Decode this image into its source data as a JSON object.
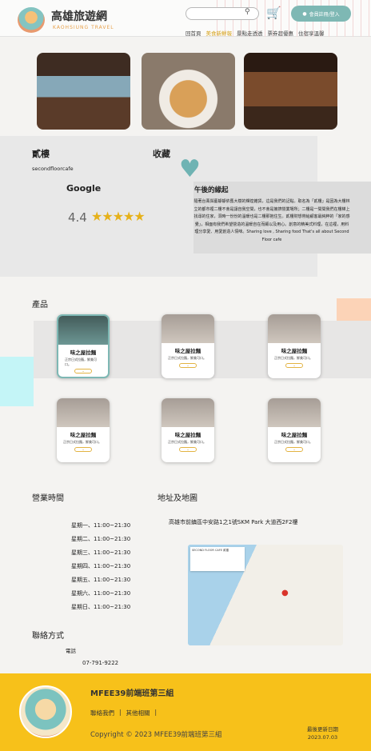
{
  "header": {
    "brand": "高雄旅遊網",
    "brand_en": "KAOHSIUNG TRAVEL",
    "login_label": "會員註冊/登入",
    "nav": [
      "回首頁",
      "美食新鮮報",
      "景點走透透",
      "票券超優惠",
      "住宿享溫馨"
    ],
    "active_nav": "美食新鮮報"
  },
  "shop": {
    "name": "貳樓",
    "name_en": "secondfloorcafe",
    "favorite_label": "收藏",
    "rating_source": "Google",
    "rating": "4.4",
    "stars": "★★★★★"
  },
  "story": {
    "title": "午後的緣起",
    "text": "隨著台菁與藝靜靜依舊大樹的輝煌雜貨，這是我們的記點。取名為「貳樓」是因為大樓林立的都市裡二樓不會是讓自我空間，也不會是擁擠營業場所；二樓是一間間我們在樓梯上找尋的住家，洞時一份份的溫暖也是二樓那抱住生。貳樓財想帶給顧客最純粹的「家的感覺」，相面有我們希望營造的溫暖自在而顯以及用心。創意的精美式料理，在這裡，用料理分享愛、用愛創造人情味。Sharing love , Sharing food That's all about Second Floor cafe"
  },
  "products": {
    "title": "產品",
    "items": [
      {
        "name": "味之屋拉麵",
        "desc": "正宗日式拉麵，鮮美可口。",
        "selected": true
      },
      {
        "name": "味之屋拉麵",
        "desc": "正宗日式拉麵，鮮美可口。",
        "selected": false
      },
      {
        "name": "味之屋拉麵",
        "desc": "正宗日式拉麵，鮮美可口。",
        "selected": false
      },
      {
        "name": "味之屋拉麵",
        "desc": "正宗日式拉麵，鮮美可口。",
        "selected": false
      },
      {
        "name": "味之屋拉麵",
        "desc": "正宗日式拉麵，鮮美可口。",
        "selected": false
      },
      {
        "name": "味之屋拉麵",
        "desc": "正宗日式拉麵，鮮美可口。",
        "selected": false
      }
    ]
  },
  "hours": {
    "title": "營業時間",
    "rows": [
      "星期一、11:00~21:30",
      "星期二、11:00~21:30",
      "星期三、11:00~21:30",
      "星期四、11:00~21:30",
      "星期五、11:00~21:30",
      "星期六、11:00~21:30",
      "星期日、11:00~21:30"
    ]
  },
  "address": {
    "title": "地址及地圖",
    "text": "高雄市前鎮區中安路1之1號SKM Park 大道西2F2樓",
    "map_place": "SECOND FLOOR CAFE 貳樓"
  },
  "contact": {
    "title": "聯絡方式",
    "phone_label": "電話",
    "phone": "07-791-9222"
  },
  "footer": {
    "title": "MFEE39前端班第三組",
    "links": [
      "聯絡我們",
      "其他相關"
    ],
    "copyright": "Copyright © 2023 MFEE39前端班第三組",
    "updated_label": "最後更新日期",
    "updated_date": "2023.07.03"
  }
}
